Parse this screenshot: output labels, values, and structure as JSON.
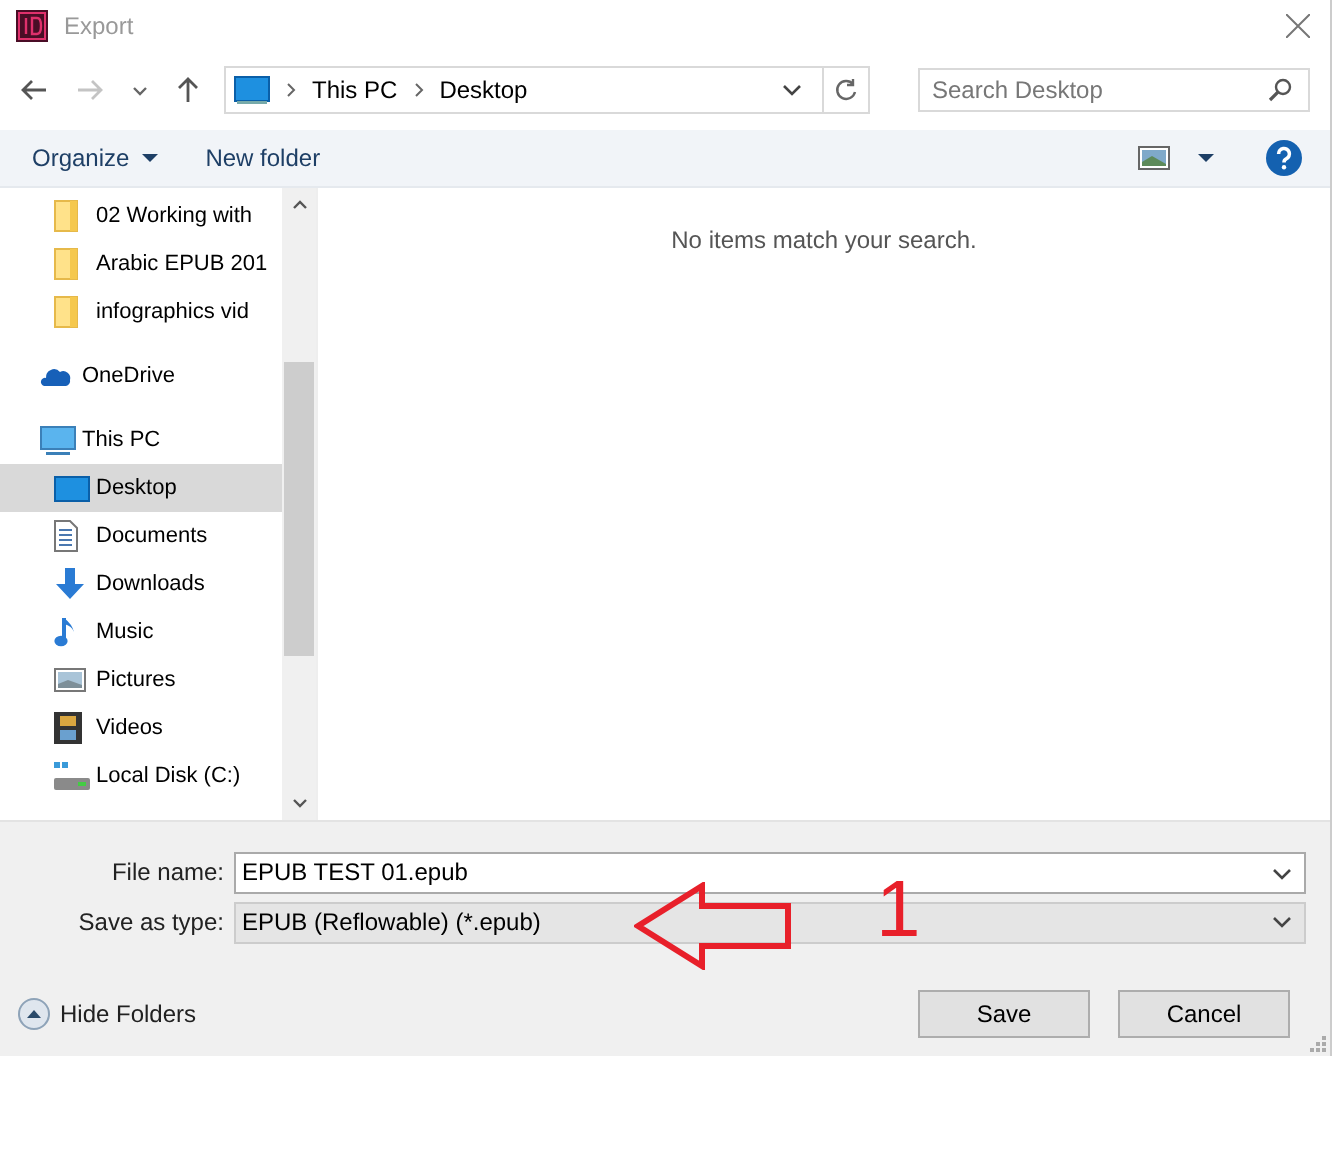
{
  "window": {
    "title": "Export"
  },
  "nav": {
    "path": [
      "This PC",
      "Desktop"
    ],
    "search": {
      "placeholder": "Search Desktop"
    }
  },
  "toolbar": {
    "organize": "Organize",
    "new_folder": "New folder"
  },
  "sidebar": {
    "tree": [
      {
        "children": [
          {
            "label": "02 Working with",
            "kind": "folder",
            "selected": false
          },
          {
            "label": "Arabic EPUB 201",
            "kind": "folder",
            "selected": false
          },
          {
            "label": "infographics vid",
            "kind": "folder",
            "selected": false
          }
        ]
      },
      {
        "label": "OneDrive",
        "kind": "cloud",
        "selected": false
      },
      {
        "label": "This PC",
        "kind": "pc",
        "selected": false,
        "children": [
          {
            "label": "Desktop",
            "kind": "desktop",
            "selected": true
          },
          {
            "label": "Documents",
            "kind": "documents",
            "selected": false
          },
          {
            "label": "Downloads",
            "kind": "downloads",
            "selected": false
          },
          {
            "label": "Music",
            "kind": "music",
            "selected": false
          },
          {
            "label": "Pictures",
            "kind": "pictures",
            "selected": false
          },
          {
            "label": "Videos",
            "kind": "videos",
            "selected": false
          },
          {
            "label": "Local Disk (C:)",
            "kind": "disk",
            "selected": false
          }
        ]
      }
    ]
  },
  "content": {
    "empty_message": "No items match your search."
  },
  "form": {
    "file_name_label": "File name:",
    "file_name": "EPUB TEST 01.epub",
    "type_label": "Save as type:",
    "type": "EPUB (Reflowable) (*.epub)"
  },
  "annotation": {
    "number": "1"
  },
  "hide_folders": "Hide Folders",
  "buttons": [
    "Save",
    "Cancel"
  ]
}
